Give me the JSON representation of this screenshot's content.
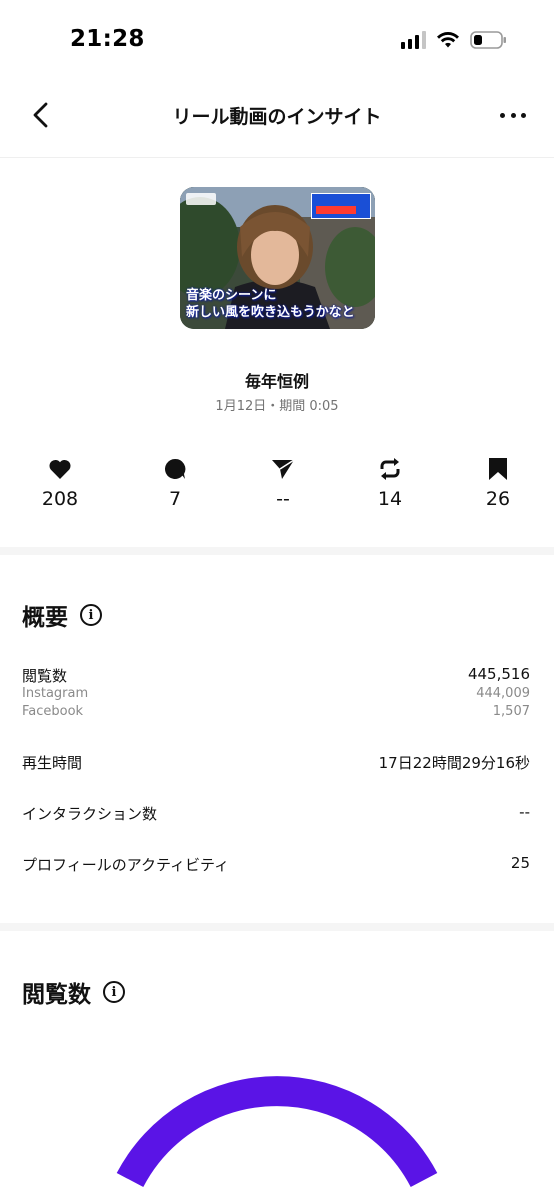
{
  "status_bar": {
    "time": "21:28"
  },
  "nav": {
    "title": "リール動画のインサイト"
  },
  "reel": {
    "thumbnail_caption_line1": "音楽のシーンに",
    "thumbnail_caption_line2": "新しい風を吹き込もうかなと",
    "title": "毎年恒例",
    "meta": "1月12日・期間 0:05"
  },
  "stats": {
    "likes": "208",
    "comments": "7",
    "shares": "--",
    "reposts": "14",
    "saves": "26"
  },
  "overview": {
    "heading": "概要",
    "views_label": "閲覧数",
    "views_value": "445,516",
    "instagram_label": "Instagram",
    "instagram_value": "444,009",
    "facebook_label": "Facebook",
    "facebook_value": "1,507",
    "watch_time_label": "再生時間",
    "watch_time_value": "17日22時間29分16秒",
    "interactions_label": "インタラクション数",
    "interactions_value": "--",
    "profile_activity_label": "プロフィールのアクティビティ",
    "profile_activity_value": "25"
  },
  "views_section": {
    "heading": "閲覧数"
  },
  "colors": {
    "accent": "#5a14e6",
    "secondary_text": "#737373",
    "divider": "#f5f5f5"
  },
  "icons": {
    "likes": "heart-icon",
    "comments": "comment-bubble-icon",
    "shares": "send-paper-plane-icon",
    "reposts": "repost-arrows-icon",
    "saves": "bookmark-icon"
  }
}
